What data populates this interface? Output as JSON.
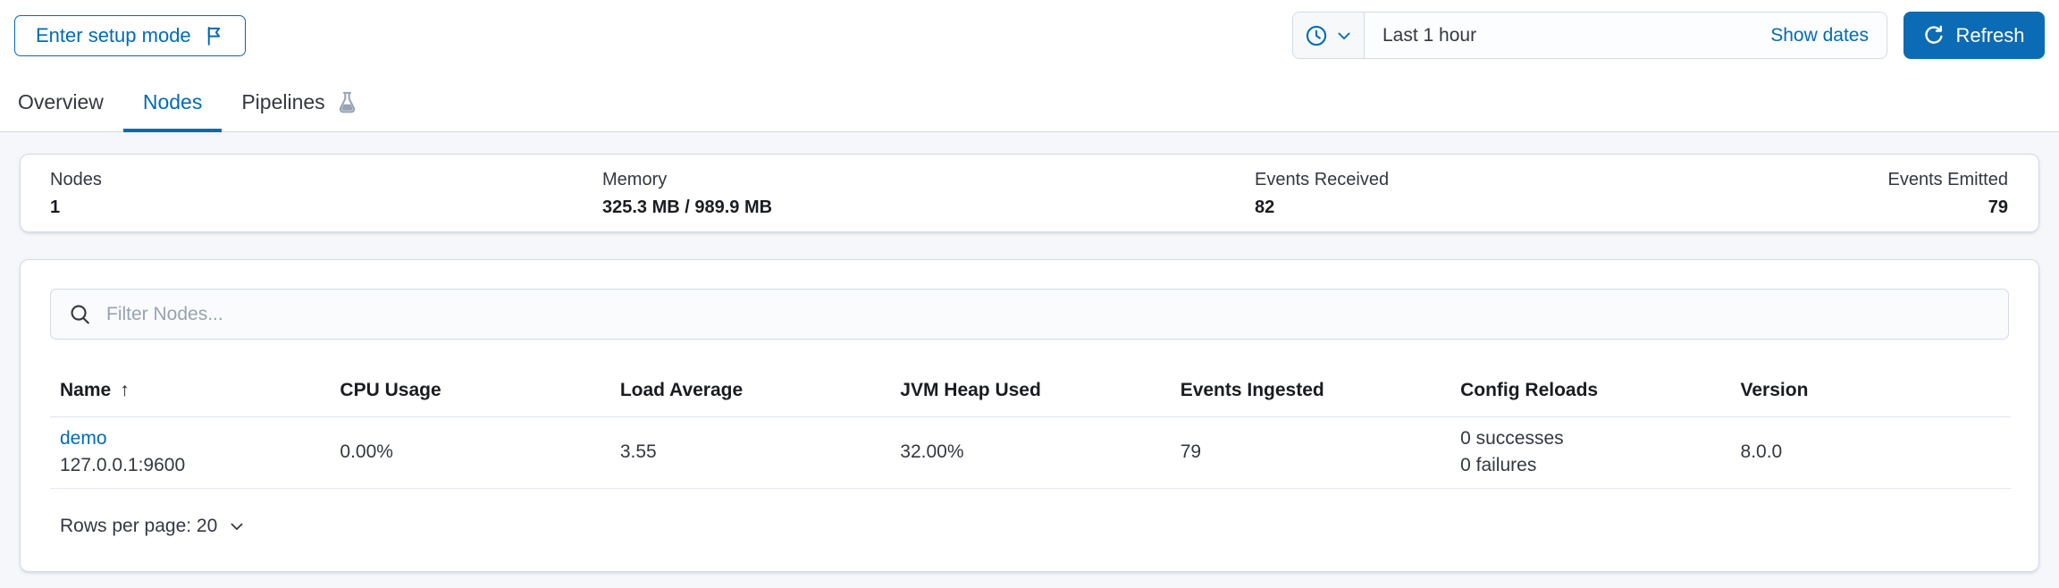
{
  "header": {
    "setup_button_label": "Enter setup mode",
    "time_picker": {
      "selected_range": "Last 1 hour",
      "show_dates_label": "Show dates"
    },
    "refresh_button_label": "Refresh"
  },
  "tabs": [
    {
      "label": "Overview",
      "active": false
    },
    {
      "label": "Nodes",
      "active": true
    },
    {
      "label": "Pipelines",
      "active": false,
      "icon": "beaker-icon"
    }
  ],
  "summary": {
    "stats": [
      {
        "label": "Nodes",
        "value": "1"
      },
      {
        "label": "Memory",
        "value": "325.3 MB / 989.9 MB"
      },
      {
        "label": "Events Received",
        "value": "82"
      },
      {
        "label": "Events Emitted",
        "value": "79"
      }
    ]
  },
  "nodes_panel": {
    "filter": {
      "placeholder": "Filter Nodes..."
    },
    "table": {
      "columns": [
        "Name",
        "CPU Usage",
        "Load Average",
        "JVM Heap Used",
        "Events Ingested",
        "Config Reloads",
        "Version"
      ],
      "sort": {
        "column": "Name",
        "direction": "asc",
        "arrow": "↑"
      },
      "rows": [
        {
          "name": "demo",
          "address": "127.0.0.1:9600",
          "cpu_usage": "0.00%",
          "load_average": "3.55",
          "jvm_heap_used": "32.00%",
          "events_ingested": "79",
          "config_reloads": {
            "successes": "0 successes",
            "failures": "0 failures"
          },
          "version": "8.0.0"
        }
      ]
    },
    "pagination": {
      "rows_per_page_label": "Rows per page: 20"
    }
  },
  "colors": {
    "accent_blue": "#006BB4",
    "refresh_button_bg": "#0b6bb4",
    "page_background": "#f5f7fa",
    "panel_border": "#d3dae6",
    "text_dark": "#1a1c21",
    "text_body": "#343741",
    "placeholder_gray": "#98a2b3"
  }
}
